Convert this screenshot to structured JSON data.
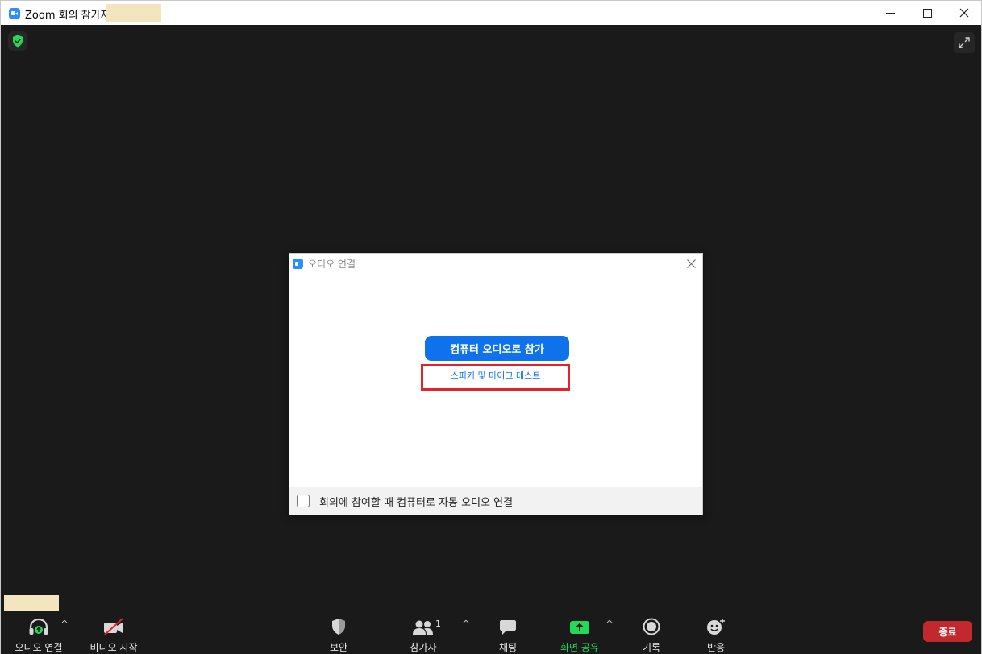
{
  "window": {
    "title": "Zoom 회의 참가자",
    "icon": "zoom-icon"
  },
  "dialog": {
    "title": "오디오 연결",
    "join_button": "컴퓨터 오디오로 참가",
    "test_link": "스피커 및 마이크 테스트",
    "auto_connect_label": "회의에 참여할 때 컴퓨터로 자동 오디오 연결",
    "auto_connect_checked": false
  },
  "toolbar": {
    "audio": "오디오 연결",
    "video": "비디오 시작",
    "security": "보안",
    "participants": "참가자",
    "participant_count": "1",
    "chat": "채팅",
    "share": "화면 공유",
    "record": "기록",
    "reactions": "반응",
    "end": "종료"
  },
  "colors": {
    "accent_blue": "#0e72ed",
    "highlight_red": "#e3222e",
    "share_green": "#23d959",
    "end_red": "#c3282e",
    "meeting_bg": "#1a1a1a"
  }
}
